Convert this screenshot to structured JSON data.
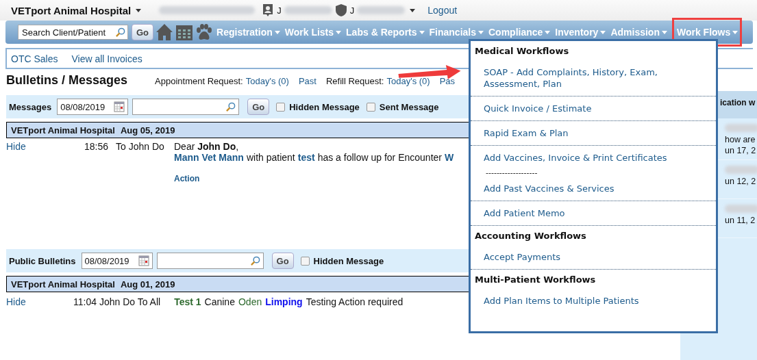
{
  "header": {
    "clinic": "VETport Animal Hospital",
    "user_1": "J",
    "user_2": "J",
    "logout": "Logout"
  },
  "nav": {
    "search": {
      "placeholder": "Search Client/Patient"
    },
    "go": "Go",
    "menus": [
      {
        "label": "Registration",
        "open": false
      },
      {
        "label": "Work Lists",
        "open": false
      },
      {
        "label": "Labs & Reports",
        "open": false
      },
      {
        "label": "Financials",
        "open": false
      },
      {
        "label": "Compliance",
        "open": false
      },
      {
        "label": "Inventory",
        "open": false
      },
      {
        "label": "Admission",
        "open": false
      },
      {
        "label": "Work Flows",
        "open": true
      }
    ]
  },
  "subnav": [
    "OTC Sales",
    "View all Invoices"
  ],
  "title": "Bulletins / Messages",
  "requests": [
    {
      "label": "Appointment Request:",
      "today": "Today's (0)",
      "past": "Past"
    },
    {
      "label": "Refill Request:",
      "today": "Today's (0)",
      "past": "Pas"
    }
  ],
  "messages": {
    "label": "Messages",
    "date": "08/08/2019",
    "go": "Go",
    "checkboxes": [
      {
        "label": "Hidden Message",
        "checked": false
      },
      {
        "label": "Sent Message",
        "checked": false
      }
    ],
    "group": {
      "clinic": "VETport Animal Hospital",
      "date": "Aug 05, 2019"
    },
    "row": {
      "hide": "Hide",
      "time": "18:56",
      "to": "To John Do",
      "greeting": "Dear **John Do**,",
      "parts": [
        {
          "kind": "link",
          "text": "Mann Vet Mann"
        },
        {
          "kind": "text",
          "text": "with patient"
        },
        {
          "kind": "link",
          "text": "test"
        },
        {
          "kind": "text",
          "text": "has a follow up for Encounter"
        },
        {
          "kind": "link",
          "text": "W"
        }
      ],
      "action": "Action"
    }
  },
  "bulletins": {
    "label": "Public Bulletins",
    "date": "08/08/2019",
    "go": "Go",
    "checkboxes": [
      {
        "label": "Hidden Message",
        "checked": false
      }
    ],
    "group": {
      "clinic": "VETport Animal Hospital",
      "date": "Aug 01, 2019"
    },
    "row": {
      "hide": "Hide",
      "meta": "11:04 John Do To All",
      "parts": [
        {
          "kind": "title",
          "text": "Test 1"
        },
        {
          "kind": "text",
          "text": "Canine"
        },
        {
          "kind": "patient",
          "text": "Oden"
        },
        {
          "kind": "problem",
          "text": "Limping"
        },
        {
          "kind": "text",
          "text": "Testing Action required"
        }
      ]
    }
  },
  "side_panel": {
    "header": "ication w",
    "items": [
      {
        "lines": [
          "how are",
          "un 17, 2"
        ]
      },
      {
        "lines": [
          "un 12, 2"
        ]
      },
      {
        "lines": [
          "un 11, 2"
        ]
      }
    ]
  },
  "dropdown": {
    "sections": [
      {
        "title": "Medical Workflows",
        "items": [
          {
            "kind": "link",
            "label": "SOAP - Add Complaints, History, Exam, Assessment, Plan"
          },
          {
            "kind": "link",
            "label": "Quick Invoice / Estimate"
          },
          {
            "kind": "link",
            "label": "Rapid Exam & Plan"
          },
          {
            "kind": "link",
            "label": "Add Vaccines, Invoice & Print Certificates"
          },
          {
            "kind": "separator",
            "label": "-------------------"
          },
          {
            "kind": "link",
            "label": "Add Past Vaccines & Services"
          },
          {
            "kind": "link",
            "label": "Add Patient Memo"
          }
        ]
      },
      {
        "title": "Accounting Workflows",
        "items": [
          {
            "kind": "link",
            "label": "Accept Payments"
          }
        ]
      },
      {
        "title": "Multi-Patient Workflows",
        "items": [
          {
            "kind": "link",
            "label": "Add Plan Items to Multiple Patients"
          }
        ]
      }
    ]
  }
}
